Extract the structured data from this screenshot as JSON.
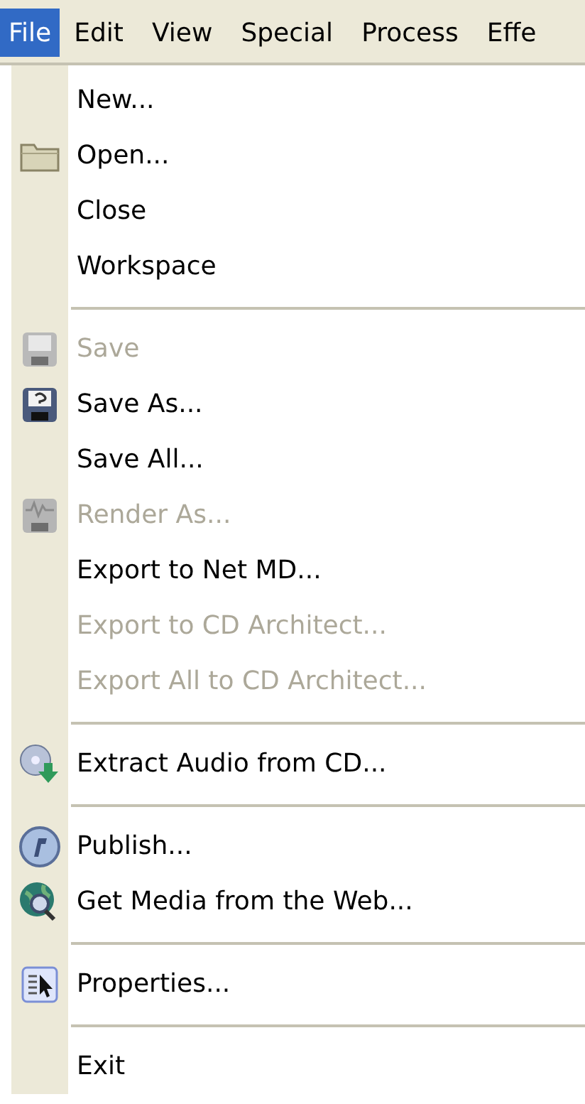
{
  "menubar": [
    {
      "label": "File",
      "selected": true
    },
    {
      "label": "Edit",
      "selected": false
    },
    {
      "label": "View",
      "selected": false
    },
    {
      "label": "Special",
      "selected": false
    },
    {
      "label": "Process",
      "selected": false
    },
    {
      "label": "Effe",
      "selected": false
    }
  ],
  "menu": [
    {
      "kind": "item",
      "label": "New...",
      "disabled": false
    },
    {
      "kind": "item",
      "label": "Open...",
      "disabled": false
    },
    {
      "kind": "item",
      "label": "Close",
      "disabled": false
    },
    {
      "kind": "item",
      "label": "Workspace",
      "disabled": false
    },
    {
      "kind": "separator"
    },
    {
      "kind": "item",
      "label": "Save",
      "disabled": true
    },
    {
      "kind": "item",
      "label": "Save As...",
      "disabled": false
    },
    {
      "kind": "item",
      "label": "Save All...",
      "disabled": false
    },
    {
      "kind": "item",
      "label": "Render As...",
      "disabled": true
    },
    {
      "kind": "item",
      "label": "Export to Net MD...",
      "disabled": false
    },
    {
      "kind": "item",
      "label": "Export to CD Architect...",
      "disabled": true
    },
    {
      "kind": "item",
      "label": "Export All to CD Architect...",
      "disabled": true
    },
    {
      "kind": "separator"
    },
    {
      "kind": "item",
      "label": "Extract Audio from CD...",
      "disabled": false
    },
    {
      "kind": "separator"
    },
    {
      "kind": "item",
      "label": "Publish...",
      "disabled": false
    },
    {
      "kind": "item",
      "label": "Get Media from the Web...",
      "disabled": false
    },
    {
      "kind": "separator"
    },
    {
      "kind": "item",
      "label": "Properties...",
      "disabled": false
    },
    {
      "kind": "separator"
    },
    {
      "kind": "item",
      "label": "Exit",
      "disabled": false
    }
  ]
}
